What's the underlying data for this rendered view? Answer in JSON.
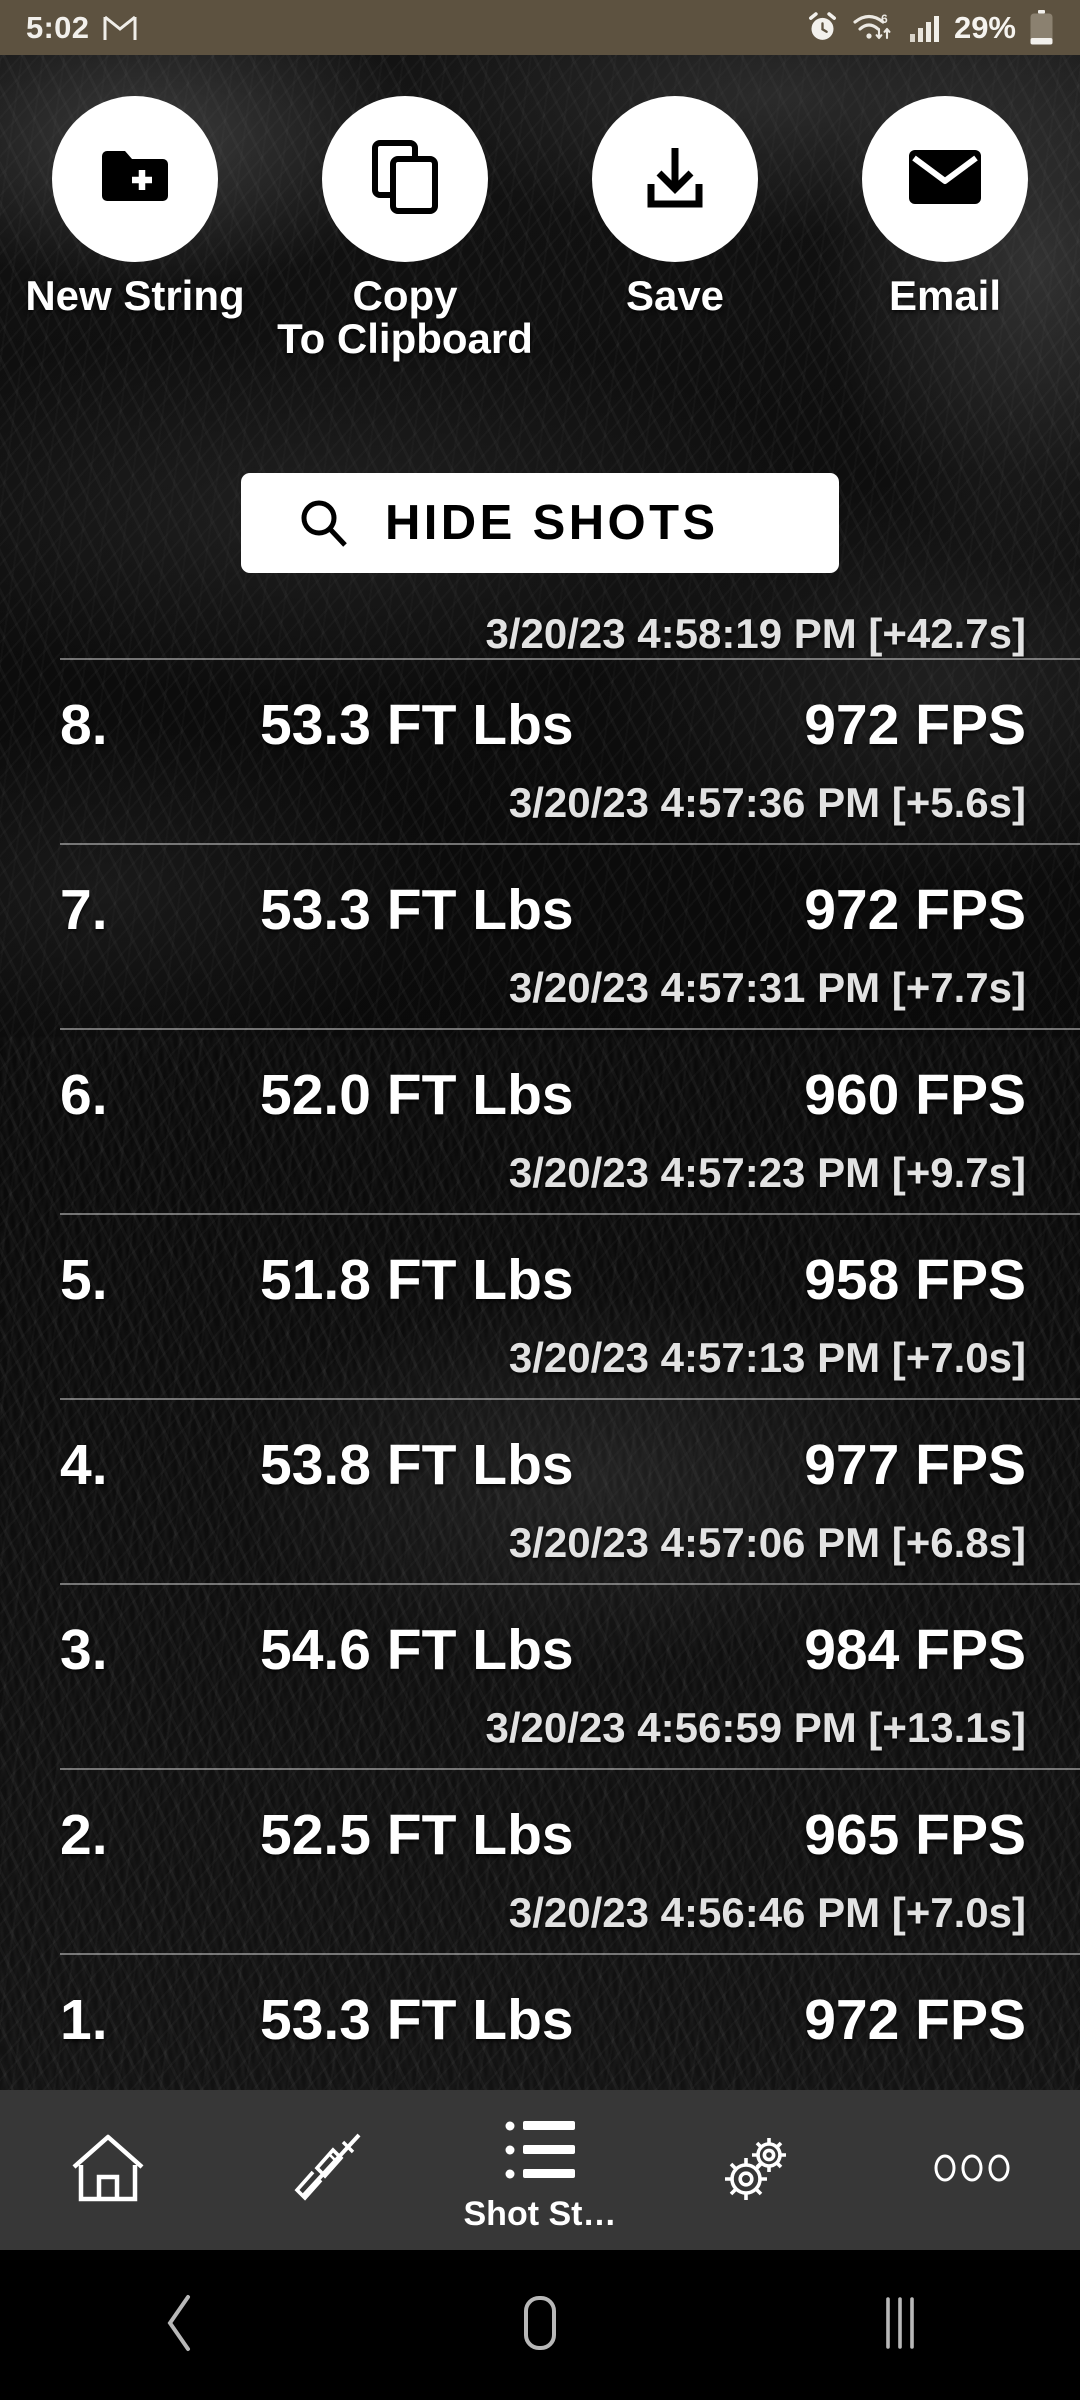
{
  "status_bar": {
    "time": "5:02",
    "gmail_icon": "gmail-icon",
    "alarm_icon": "alarm-icon",
    "wifi_icon": "wifi-6-icon",
    "signal_icon": "cellular-signal-icon",
    "battery_percent": "29%",
    "battery_icon": "battery-low-icon",
    "background_color": "#5d5240"
  },
  "actions": [
    {
      "label": "New String",
      "icon": "folder-plus-icon"
    },
    {
      "label": "Copy\nTo Clipboard",
      "icon": "copy-icon"
    },
    {
      "label": "Save",
      "icon": "download-icon"
    },
    {
      "label": "Email",
      "icon": "envelope-icon"
    }
  ],
  "hide_shots": {
    "label": "HIDE SHOTS",
    "icon": "search-icon"
  },
  "shot_list": {
    "partial_top_timestamp": "3/20/23 4:58:19 PM [+42.7s]",
    "unit_energy": "FT Lbs",
    "unit_speed": "FPS",
    "rows": [
      {
        "index": "8.",
        "energy": "53.3 FT Lbs",
        "speed": "972 FPS",
        "timestamp": "3/20/23 4:57:36 PM [+5.6s]"
      },
      {
        "index": "7.",
        "energy": "53.3 FT Lbs",
        "speed": "972 FPS",
        "timestamp": "3/20/23 4:57:31 PM [+7.7s]"
      },
      {
        "index": "6.",
        "energy": "52.0 FT Lbs",
        "speed": "960 FPS",
        "timestamp": "3/20/23 4:57:23 PM [+9.7s]"
      },
      {
        "index": "5.",
        "energy": "51.8 FT Lbs",
        "speed": "958 FPS",
        "timestamp": "3/20/23 4:57:13 PM [+7.0s]"
      },
      {
        "index": "4.",
        "energy": "53.8 FT Lbs",
        "speed": "977 FPS",
        "timestamp": "3/20/23 4:57:06 PM [+6.8s]"
      },
      {
        "index": "3.",
        "energy": "54.6 FT Lbs",
        "speed": "984 FPS",
        "timestamp": "3/20/23 4:56:59 PM [+13.1s]"
      },
      {
        "index": "2.",
        "energy": "52.5 FT Lbs",
        "speed": "965 FPS",
        "timestamp": "3/20/23 4:56:46 PM [+7.0s]"
      },
      {
        "index": "1.",
        "energy": "53.3 FT Lbs",
        "speed": "972 FPS",
        "timestamp": ""
      }
    ]
  },
  "bottom_nav": {
    "background_color": "#373737",
    "items": [
      {
        "label": "",
        "icon": "home-icon",
        "active": false
      },
      {
        "label": "",
        "icon": "rifle-icon",
        "active": false
      },
      {
        "label": "Shot St…",
        "icon": "list-icon",
        "active": true
      },
      {
        "label": "",
        "icon": "gears-icon",
        "active": false
      },
      {
        "label": "",
        "icon": "more-dots-icon",
        "active": false
      }
    ]
  },
  "android_nav": {
    "back": "back-icon",
    "home": "home-pill-icon",
    "recents": "recents-icon"
  }
}
